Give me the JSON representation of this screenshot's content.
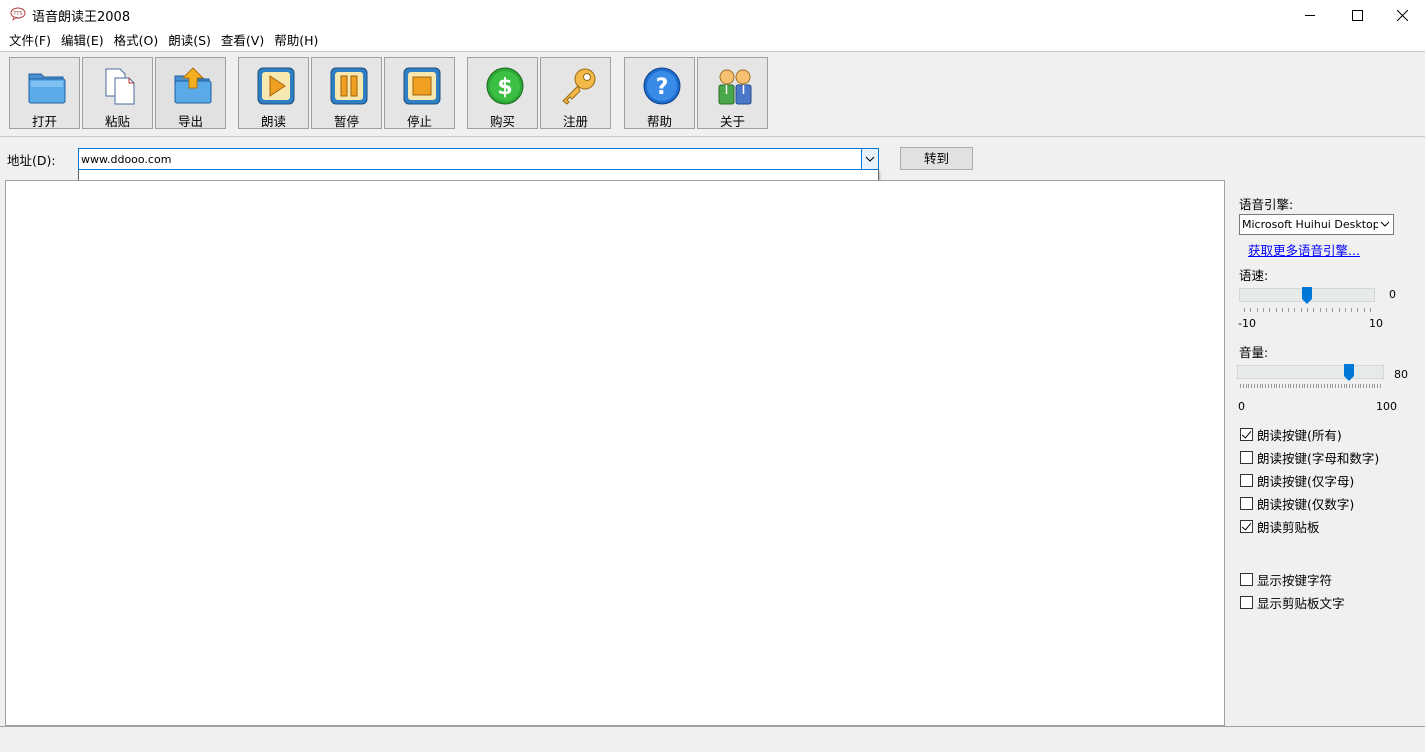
{
  "window": {
    "title": "语音朗读王2008"
  },
  "menu": [
    "文件(F)",
    "编辑(E)",
    "格式(O)",
    "朗读(S)",
    "查看(V)",
    "帮助(H)"
  ],
  "toolbar": {
    "open": "打开",
    "paste": "粘贴",
    "export": "导出",
    "read": "朗读",
    "pause": "暂停",
    "stop": "停止",
    "buy": "购买",
    "register": "注册",
    "help": "帮助",
    "about": "关于"
  },
  "address": {
    "label": "地址(D):",
    "value": "www.ddooo.com",
    "go": "转到"
  },
  "side": {
    "engine_label": "语音引擎:",
    "engine_value": "Microsoft Huihui Desktop - Chinese",
    "engine_link": "获取更多语音引擎...",
    "speed_label": "语速:",
    "speed_value": "0",
    "speed_min": "-10",
    "speed_max": "10",
    "speed_level": 0.5,
    "volume_label": "音量:",
    "volume_value": "80",
    "volume_min": "0",
    "volume_max": "100",
    "volume_level": 0.8,
    "checks": [
      {
        "label": "朗读按键(所有)",
        "checked": true
      },
      {
        "label": "朗读按键(字母和数字)",
        "checked": false
      },
      {
        "label": "朗读按键(仅字母)",
        "checked": false
      },
      {
        "label": "朗读按键(仅数字)",
        "checked": false
      },
      {
        "label": "朗读剪贴板",
        "checked": true
      }
    ],
    "checks2": [
      {
        "label": "显示按键字符",
        "checked": false
      },
      {
        "label": "显示剪贴板文字",
        "checked": false
      }
    ]
  }
}
